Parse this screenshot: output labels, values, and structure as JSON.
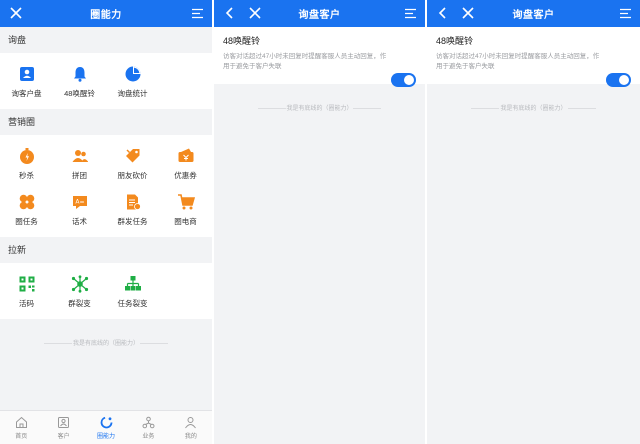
{
  "colors": {
    "primary": "#1a73f0",
    "orange": "#f38a1e",
    "green": "#1fae45"
  },
  "panel1": {
    "title": "圈能力",
    "left_icon": "close-icon",
    "right_icon": "menu-icon",
    "sections": [
      {
        "title": "询盘",
        "items": [
          {
            "label": "询客户盘",
            "icon": "contact-card-icon"
          },
          {
            "label": "48唤醒铃",
            "icon": "bell-icon"
          },
          {
            "label": "询盘统计",
            "icon": "pie-chart-icon"
          }
        ]
      },
      {
        "title": "营销圈",
        "items": [
          {
            "label": "秒杀",
            "icon": "stopwatch-icon"
          },
          {
            "label": "拼团",
            "icon": "group-icon"
          },
          {
            "label": "朋友砍价",
            "icon": "price-tag-icon"
          },
          {
            "label": "优惠券",
            "icon": "coupon-icon"
          },
          {
            "label": "圈任务",
            "icon": "clover-icon"
          },
          {
            "label": "话术",
            "icon": "script-icon"
          },
          {
            "label": "群发任务",
            "icon": "broadcast-icon"
          },
          {
            "label": "圈电商",
            "icon": "cart-icon"
          }
        ]
      },
      {
        "title": "拉新",
        "items": [
          {
            "label": "活码",
            "icon": "qr-code-icon"
          },
          {
            "label": "群裂变",
            "icon": "network-icon"
          },
          {
            "label": "任务裂变",
            "icon": "hierarchy-icon"
          }
        ]
      }
    ],
    "footer_text": "我是有底线的（圈能力）",
    "tabs": [
      {
        "label": "首页",
        "icon": "home-icon",
        "active": false
      },
      {
        "label": "客户",
        "icon": "customer-icon",
        "active": false
      },
      {
        "label": "圈能力",
        "icon": "ability-icon",
        "active": true
      },
      {
        "label": "业务",
        "icon": "business-icon",
        "active": false
      },
      {
        "label": "我的",
        "icon": "profile-icon",
        "active": false
      }
    ]
  },
  "panel2": {
    "title": "询盘客户",
    "setting_title": "48唤醒铃",
    "setting_desc": "访客对话超过47小时未回复时提醒客服人员主动回复，作用于避免于客户失联",
    "toggle_on": true,
    "footer_text": "我是有底线的（圈能力）"
  },
  "panel3": {
    "title": "询盘客户",
    "setting_title": "48唤醒铃",
    "setting_desc": "访客对话超过47小时未回复时提醒客服人员主动回复，作用于避免于客户失联",
    "toggle_on": true,
    "footer_text": "我是有底线的（圈能力）"
  }
}
